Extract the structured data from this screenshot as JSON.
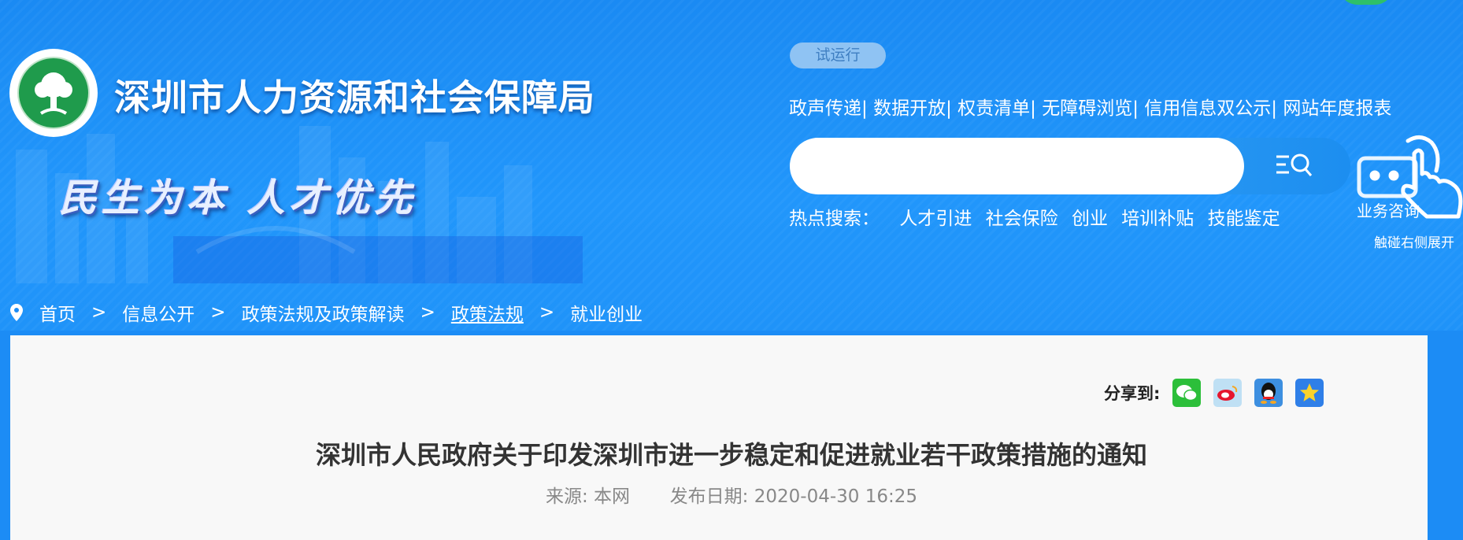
{
  "header": {
    "site_title": "深圳市人力资源和社会保障局",
    "slogan": "民生为本  人才优先",
    "trial_badge": "试运行",
    "top_links": [
      "政声传递|",
      "数据开放|",
      "权责清单|",
      "无障碍浏览|",
      "信用信息双公示|",
      "网站年度报表"
    ],
    "search": {
      "value": "",
      "placeholder": ""
    },
    "hot_search": {
      "label": "热点搜索：",
      "items": [
        "人才引进",
        "社会保险",
        "创业",
        "培训补贴",
        "技能鉴定"
      ]
    },
    "consult_label": "业务咨询",
    "expand_hint": "触碰右侧展开"
  },
  "breadcrumb": {
    "items": [
      "首页",
      "信息公开",
      "政策法规及政策解读",
      "政策法规",
      "就业创业"
    ],
    "separator": ">"
  },
  "article": {
    "share_label": "分享到:",
    "share_icons": [
      "wechat-icon",
      "weibo-icon",
      "qq-icon",
      "qzone-icon"
    ],
    "title": "深圳市人民政府关于印发深圳市进一步稳定和促进就业若干政策措施的通知",
    "source": "来源: 本网",
    "publish_date": "发布日期:  2020-04-30 16:25"
  },
  "colors": {
    "header_blue": "#1c8cf5",
    "content_bg": "#f8f8f8",
    "title_text": "#333333",
    "meta_text": "#888888"
  }
}
